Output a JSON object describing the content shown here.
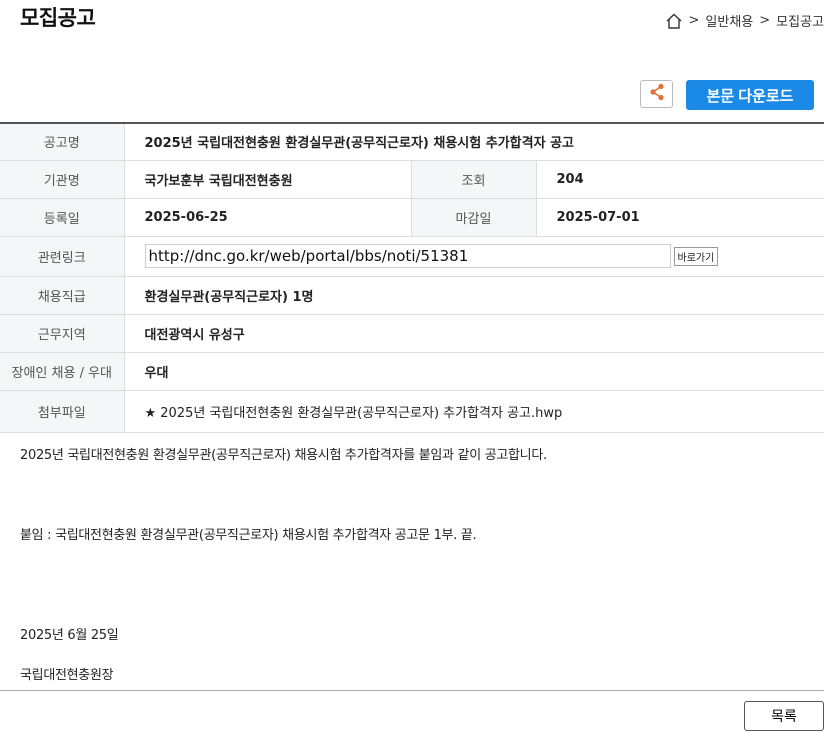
{
  "page_title": "모집공고",
  "breadcrumb": {
    "sep1": ">",
    "item1": "일반채용",
    "sep2": ">",
    "item2": "모집공고"
  },
  "toolbar": {
    "download_label": "본문 다운로드"
  },
  "table": {
    "title_label": "공고명",
    "title_value": "2025년 국립대전현충원 환경실무관(공무직근로자) 채용시험 추가합격자 공고",
    "org_label": "기관명",
    "org_value": "국가보훈부 국립대전현충원",
    "views_label": "조회",
    "views_value": "204",
    "reg_label": "등록일",
    "reg_value": "2025-06-25",
    "deadline_label": "마감일",
    "deadline_value": "2025-07-01",
    "link_label": "관련링크",
    "link_value": "http://dnc.go.kr/web/portal/bbs/noti/51381",
    "go_label": "바로가기",
    "position_label": "채용직급",
    "position_value": "환경실무관(공무직근로자) 1명",
    "region_label": "근무지역",
    "region_value": "대전광역시 유성구",
    "disabled_label": "장애인 채용 / 우대",
    "disabled_value": "우대",
    "attach_label": "첨부파일",
    "attach_value": "★ 2025년 국립대전현충원 환경실무관(공무직근로자) 추가합격자 공고.hwp"
  },
  "body": {
    "line1": "2025년 국립대전현충원 환경실무관(공무직근로자) 채용시험 추가합격자를 붙임과 같이 공고합니다.",
    "line2": "붙임 : 국립대전현충원 환경실무관(공무직근로자) 채용시험 추가합격자 공고문 1부.  끝.",
    "date": "2025년 6월 25일",
    "signature": "국립대전현충원장"
  },
  "list_button": "목록",
  "colors": {
    "accent": "#1a8ae6",
    "share_icon": "#e2703a",
    "header_bg": "#f5f6f8"
  }
}
